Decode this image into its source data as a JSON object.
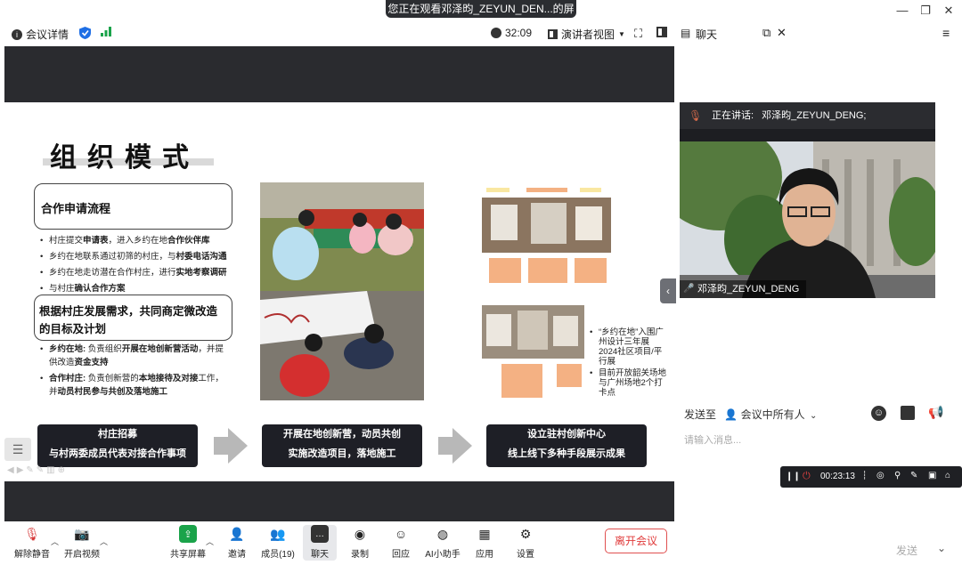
{
  "banner": {
    "text": "您正在观看邓泽昀_ZEYUN_DEN...的屏幕",
    "icon": "list-icon"
  },
  "window_controls": [
    "minimize",
    "restore",
    "close"
  ],
  "meeting_bar": {
    "info_label": "会议详情",
    "timer": "32:09",
    "view_label": "演讲者视图"
  },
  "chat_panel": {
    "title": "聊天",
    "speaking_label": "正在讲话:",
    "speaking_name": "邓泽昀_ZEYUN_DENG;",
    "video_name": "邓泽昀_ZEYUN_DENG",
    "send_to_label": "发送至",
    "send_to_target": "会议中所有人",
    "input_placeholder": "请输入消息...",
    "send_label": "发送"
  },
  "recording": {
    "time": "00:23:13"
  },
  "slide": {
    "title": "组织模式",
    "box1_title": "合作申请流程",
    "box1_bullets": [
      {
        "pre": "村庄提交",
        "bold": "申请表",
        "post": "，进入乡约在地",
        "bold2": "合作伙伴库"
      },
      {
        "pre": "乡约在地联系通过初筛的村庄，与",
        "bold": "村委电话沟通",
        "post": "",
        "bold2": ""
      },
      {
        "pre": "乡约在地走访潜在合作村庄，进行",
        "bold": "实地考察调研",
        "post": "",
        "bold2": ""
      },
      {
        "pre": "与村庄",
        "bold": "确认合作方案",
        "post": "",
        "bold2": ""
      }
    ],
    "box2_title_line1": "根据村庄发展需求，共同商定微改造",
    "box2_title_line2": "的目标及计划",
    "box2_bullets": [
      {
        "bold": "乡约在地:",
        "text": " 负责组织",
        "bold2": "开展在地创新营活动",
        "text2": "，并提供改造",
        "bold3": "资金支持"
      },
      {
        "bold": "合作村庄:",
        "text": " 负责创新营的",
        "bold2": "本地接待及对接",
        "text2": "工作，并",
        "bold3": "动员村民参与共创及落地施工"
      }
    ],
    "exhibit_bullets": [
      "“乡约在地”入围广州设计三年展2024社区项目/平行展",
      "目前开放韶关场地与广州场地2个打卡点"
    ],
    "exhibit_bold": [
      "韶关场",
      "地",
      "广州场地"
    ],
    "steps": [
      {
        "line1": "村庄招募",
        "line2": "与村两委成员代表对接合作事项"
      },
      {
        "line1": "开展在地创新营，动员共创",
        "line2": "实施改造项目，落地施工"
      },
      {
        "line1": "设立驻村创新中心",
        "line2": "线上线下多种手段展示成果"
      }
    ]
  },
  "toolbar": {
    "items": [
      {
        "label": "解除静音",
        "icon": "mic-muted-icon"
      },
      {
        "label": "开启视频",
        "icon": "camera-off-icon"
      },
      {
        "label": "共享屏幕",
        "icon": "share-screen-icon"
      },
      {
        "label": "邀请",
        "icon": "invite-icon"
      },
      {
        "label": "成员(19)",
        "icon": "members-icon"
      },
      {
        "label": "聊天",
        "icon": "chat-icon"
      },
      {
        "label": "录制",
        "icon": "record-icon"
      },
      {
        "label": "回应",
        "icon": "reaction-icon"
      },
      {
        "label": "AI小助手",
        "icon": "ai-assistant-icon"
      },
      {
        "label": "应用",
        "icon": "apps-icon"
      },
      {
        "label": "设置",
        "icon": "settings-icon"
      }
    ],
    "leave_label": "离开会议"
  },
  "colors": {
    "dark": "#2a2b2f",
    "accent_blue": "#1f6fe5",
    "signal_green": "#1aa34a",
    "leave_red": "#e03a3a",
    "slide_button": "#1e1f26"
  }
}
